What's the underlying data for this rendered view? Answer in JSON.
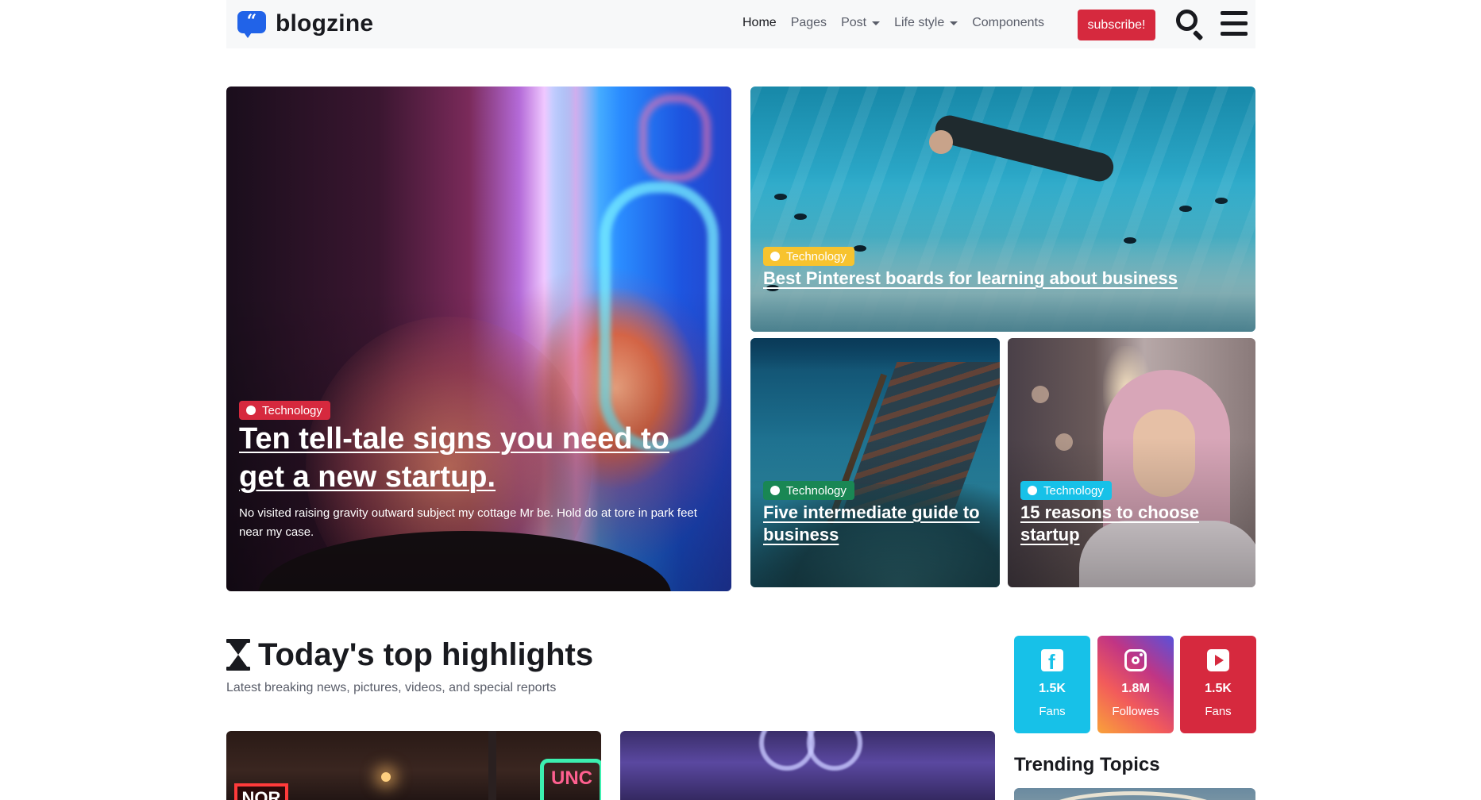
{
  "brand": {
    "name": "blogzine",
    "icon": "quote-bubble-icon",
    "color": "#2163e8"
  },
  "nav": {
    "items": [
      {
        "label": "Home",
        "active": true,
        "dropdown": false
      },
      {
        "label": "Pages",
        "active": false,
        "dropdown": false
      },
      {
        "label": "Post",
        "active": false,
        "dropdown": true
      },
      {
        "label": "Life style",
        "active": false,
        "dropdown": true
      },
      {
        "label": "Components",
        "active": false,
        "dropdown": false
      }
    ],
    "subscribe_label": "subscribe!",
    "subscribe_color": "#d6293e"
  },
  "hero": {
    "main": {
      "badge": "Technology",
      "badge_color": "#d6293e",
      "title": "Ten tell-tale signs you need to get a new startup.",
      "description": "No visited raising gravity outward subject my cottage Mr be. Hold do at tore in park feet near my case."
    },
    "top_right": {
      "badge": "Technology",
      "badge_color": "#f7c32e",
      "title": "Best Pinterest boards for learning about business"
    },
    "bottom_left": {
      "badge": "Technology",
      "badge_color": "#198754",
      "title": "Five intermediate guide to business"
    },
    "bottom_right": {
      "badge": "Technology",
      "badge_color": "#17c1e8",
      "title": "15 reasons to choose startup"
    }
  },
  "highlights": {
    "icon": "hourglass-icon",
    "title": "Today's top highlights",
    "subtitle": "Latest breaking news, pictures, videos, and special reports"
  },
  "social": [
    {
      "network": "facebook",
      "icon": "facebook-icon",
      "count": "1.5K",
      "label": "Fans",
      "color": "#17c1e8"
    },
    {
      "network": "instagram",
      "icon": "instagram-icon",
      "count": "1.8M",
      "label": "Followes",
      "color": "#c13584"
    },
    {
      "network": "youtube",
      "icon": "youtube-icon",
      "count": "1.5K",
      "label": "Fans",
      "color": "#d6293e"
    }
  ],
  "trending": {
    "title": "Trending Topics"
  },
  "thumb_signs": {
    "left": "NOR",
    "right": "UNC"
  }
}
